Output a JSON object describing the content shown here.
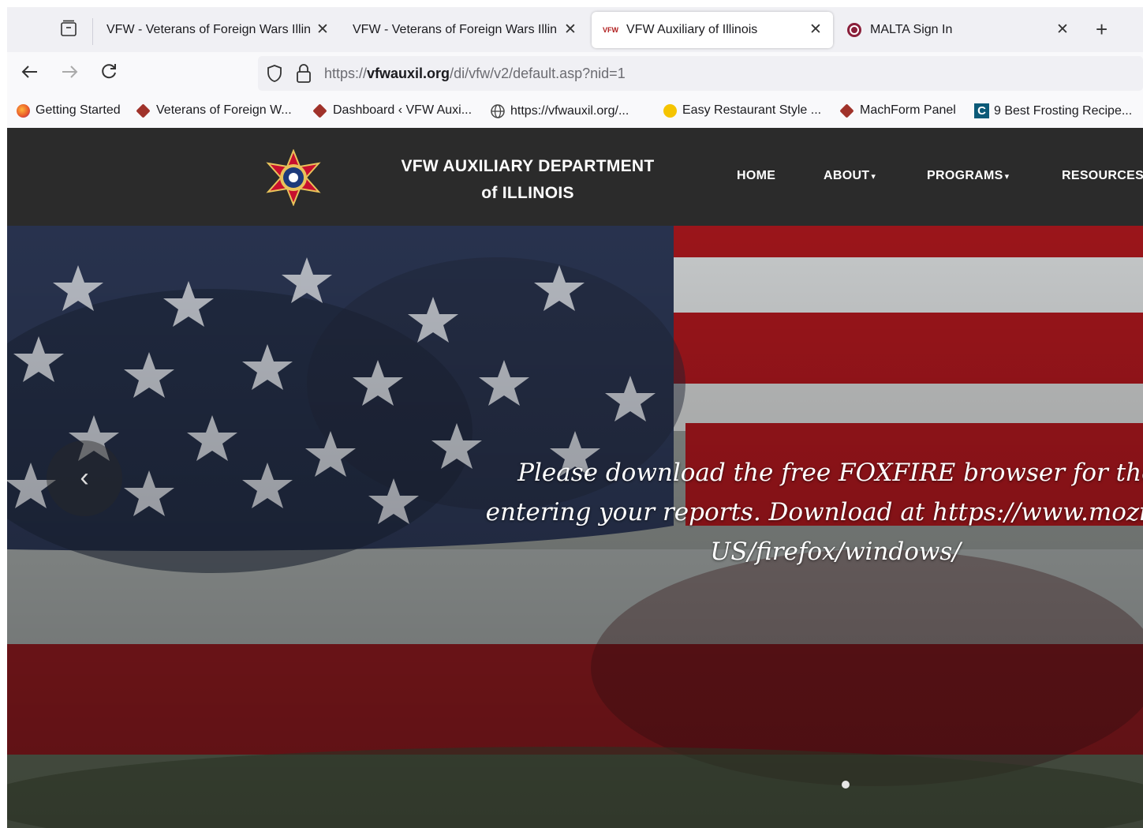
{
  "browser": {
    "tabs": [
      {
        "title": "VFW - Veterans of Foreign Wars Illin",
        "close": "✕"
      },
      {
        "title": "VFW - Veterans of Foreign Wars Illin",
        "close": "✕"
      },
      {
        "title": "VFW Auxiliary of Illinois",
        "close": "✕",
        "active": true,
        "favicon_text": "VFW"
      },
      {
        "title": "MALTA Sign In",
        "close": "✕"
      }
    ],
    "new_tab": "+",
    "url": {
      "scheme": "https://",
      "domain": "vfwauxil.org",
      "path": "/di/vfw/v2/default.asp?nid=1"
    },
    "bookmarks": [
      {
        "label": "Getting Started",
        "icon": "firefox-icon",
        "color": "#e8562a"
      },
      {
        "label": "Veterans of Foreign W...",
        "icon": "vfw-icon",
        "color": "#a0322a"
      },
      {
        "label": "Dashboard ‹ VFW Auxi...",
        "icon": "vfw-icon",
        "color": "#a0322a"
      },
      {
        "label": "https://vfwauxil.org/...",
        "icon": "globe-icon",
        "color": "#444444"
      },
      {
        "label": "Easy Restaurant Style ...",
        "icon": "star-icon",
        "color": "#f5c400"
      },
      {
        "label": "MachForm Panel",
        "icon": "vfw-icon",
        "color": "#a0322a"
      },
      {
        "label": "9 Best Frosting Recipe...",
        "icon": "c-icon",
        "color": "#0b5a78",
        "icon_text": "C"
      }
    ]
  },
  "site": {
    "title_line1": "VFW AUXILIARY DEPARTMENT",
    "title_line2": "of ILLINOIS",
    "menu": [
      "HOME",
      "ABOUT",
      "PROGRAMS",
      "RESOURCES"
    ],
    "caret": "▾"
  },
  "hero": {
    "line1": "Please download the free FOXFIRE browser for the best",
    "line2": "entering your reports. Download at https://www.mozilla.",
    "line3": "US/firefox/windows/",
    "prev": "‹"
  },
  "colors": {
    "header_bg": "#2b2b2b",
    "flag_red": "#a3161c",
    "flag_blue": "#1d2a4a"
  }
}
